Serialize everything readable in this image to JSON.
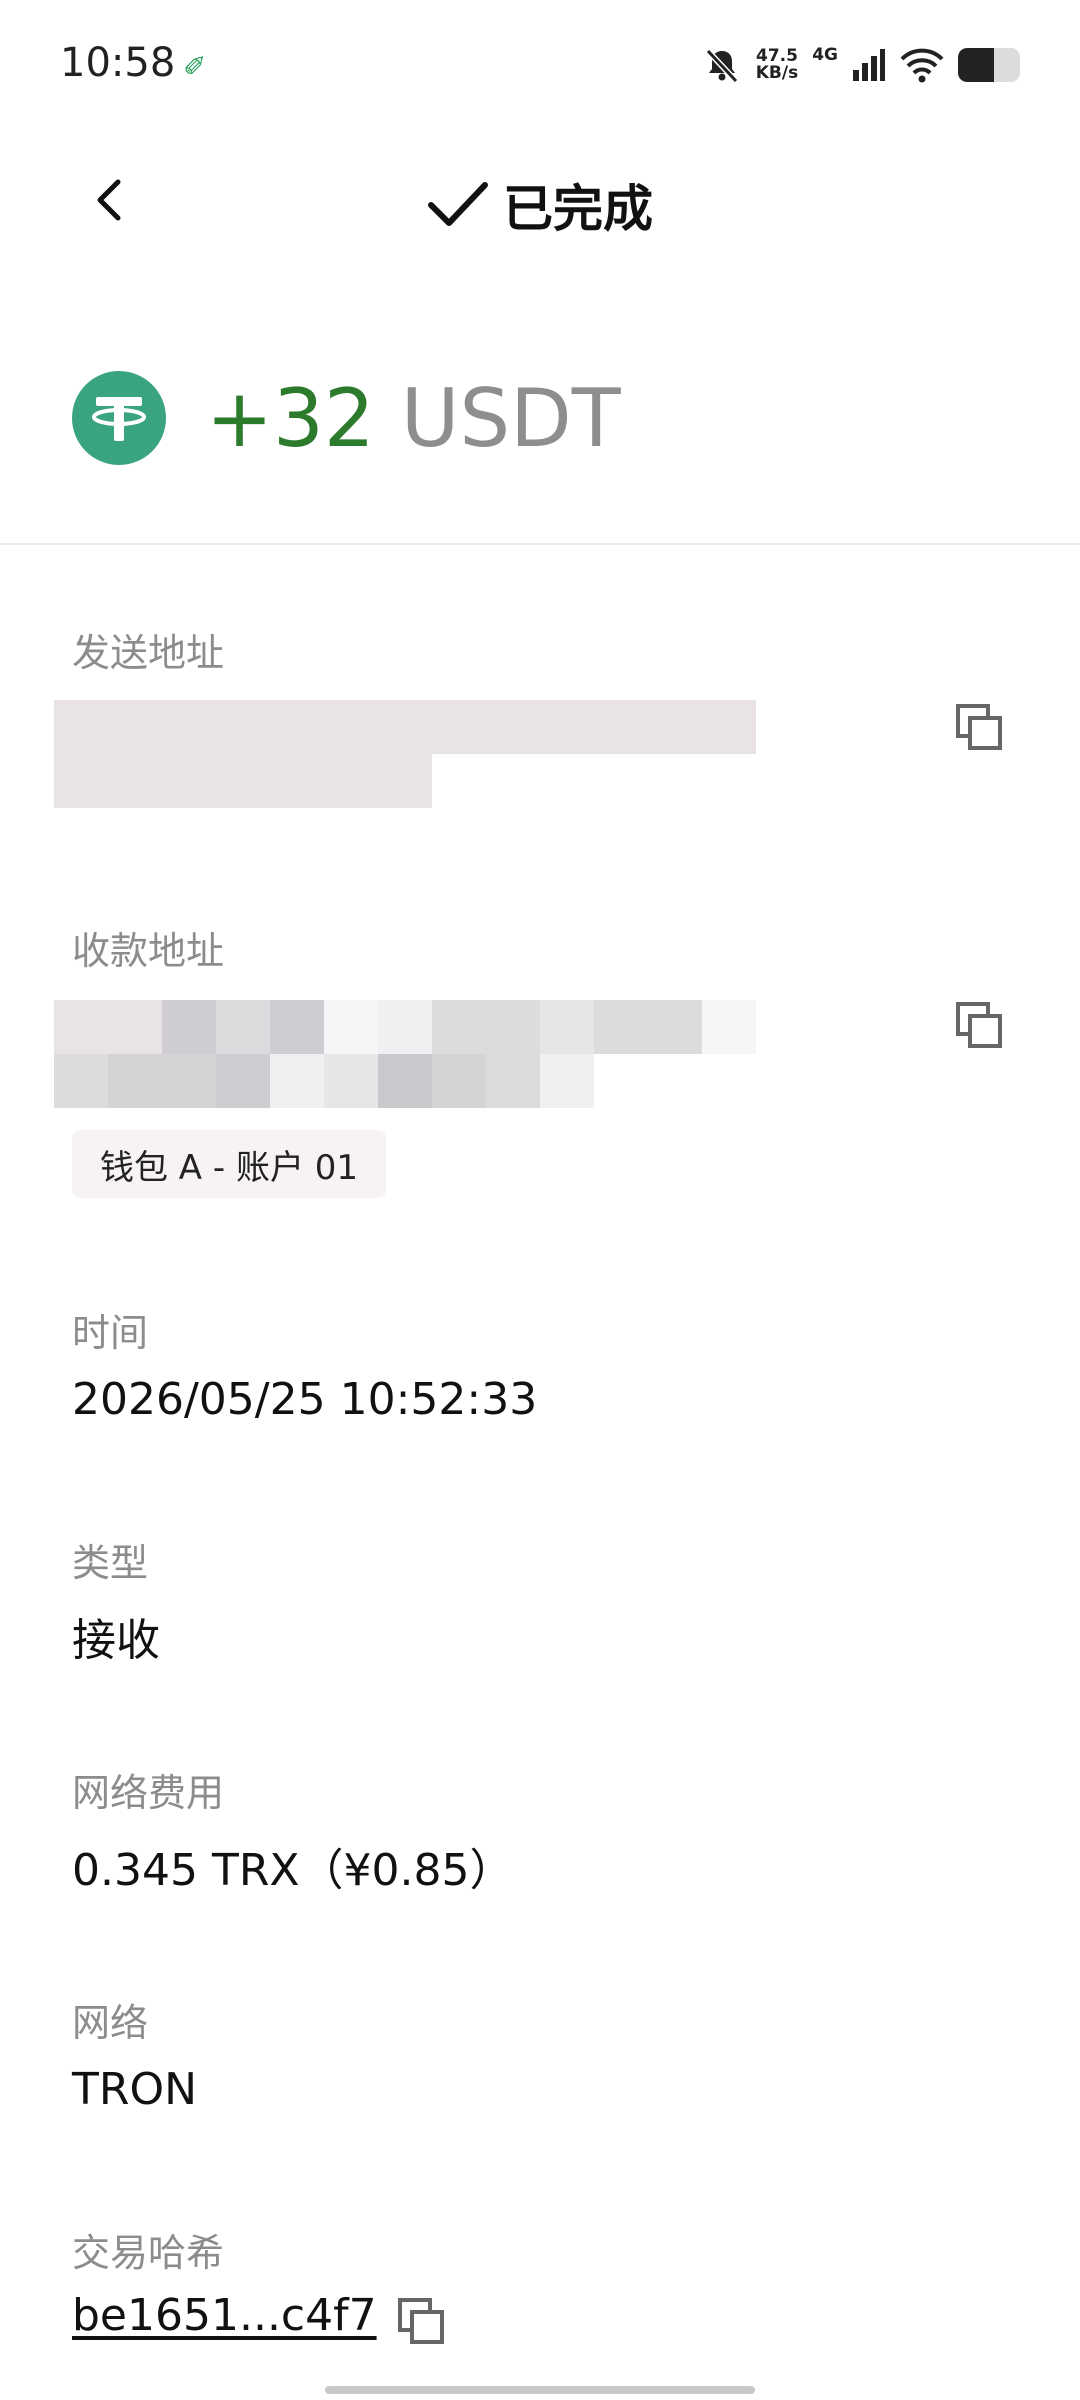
{
  "status_bar": {
    "time": "10:58",
    "speed_value": "47.5",
    "speed_unit": "KB/s",
    "network_type": "4G",
    "battery_level": 0.58
  },
  "header": {
    "title": "已完成"
  },
  "transaction": {
    "amount": "+32",
    "unit": "USDT",
    "amount_color": "#2c7a2c",
    "token_color": "#3aa37f"
  },
  "fields": {
    "sender_label": "发送地址",
    "receiver_label": "收款地址",
    "wallet_tag": "钱包 A - 账户 01",
    "time_label": "时间",
    "time_value": "2026/05/25 10:52:33",
    "type_label": "类型",
    "type_value": "接收",
    "fee_label": "网络费用",
    "fee_value": "0.345 TRX（¥0.85）",
    "network_label": "网络",
    "network_value": "TRON",
    "hash_label": "交易哈希",
    "hash_value": "be1651...c4f7"
  }
}
